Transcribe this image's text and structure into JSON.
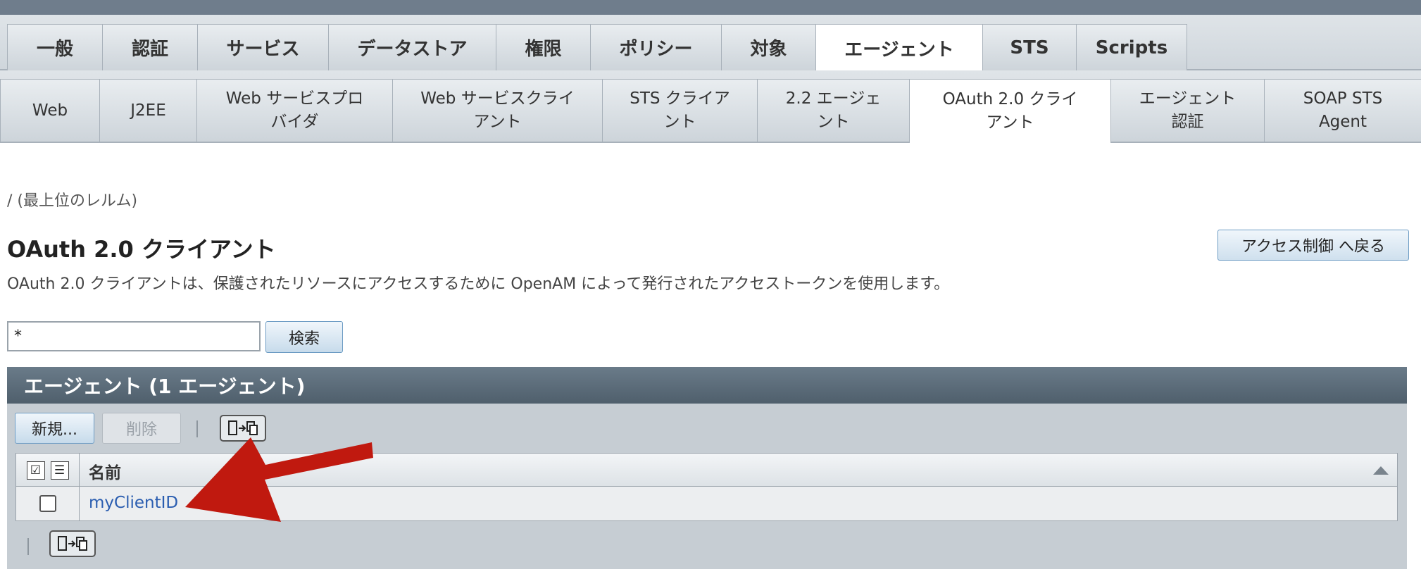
{
  "top_tabs": [
    "一般",
    "認証",
    "サービス",
    "データストア",
    "権限",
    "ポリシー",
    "対象",
    "エージェント",
    "STS",
    "Scripts"
  ],
  "sub_tabs": [
    "Web",
    "J2EE",
    "Web サービスプロ\nバイダ",
    "Web サービスクライ\nアント",
    "STS クライア\nント",
    "2.2 エージェ\nント",
    "OAuth 2.0 クライ\nアント",
    "エージェント\n認証",
    "SOAP STS\nAgent"
  ],
  "breadcrumb": "/ (最上位のレルム)",
  "page_title": "OAuth 2.0 クライアント",
  "back_button": "アクセス制御 へ戻る",
  "description": "OAuth 2.0 クライアントは、保護されたリソースにアクセスするために OpenAM によって発行されたアクセストークンを使用します。",
  "search": {
    "value": "*",
    "button": "検索"
  },
  "panel": {
    "title": "エージェント (1 エージェント)",
    "new_button": "新規...",
    "delete_button": "削除",
    "column_name": "名前",
    "rows": [
      {
        "name": "myClientID"
      }
    ]
  },
  "colors": {
    "arrow": "#c0190f",
    "link": "#2a5db0",
    "panel_header": "#5a6a77"
  }
}
